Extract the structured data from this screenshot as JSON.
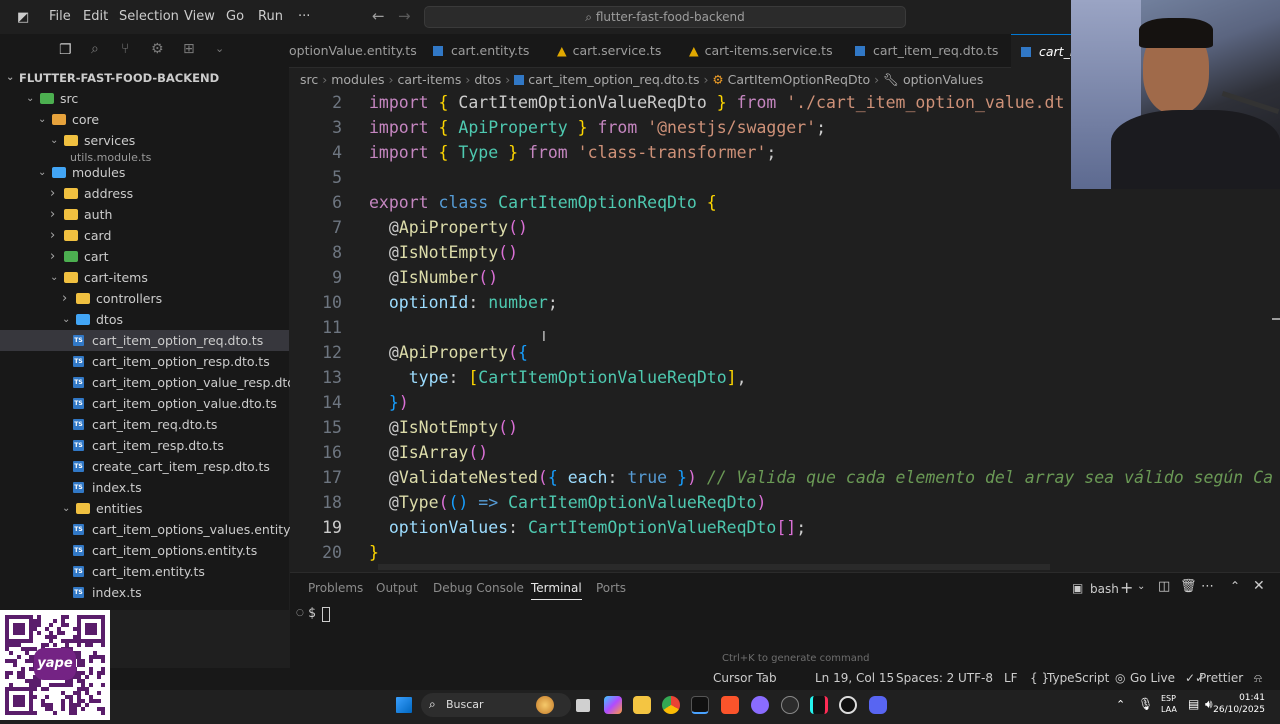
{
  "titlebar": {
    "menu": [
      "File",
      "Edit",
      "Selection",
      "View",
      "Go",
      "Run",
      "···"
    ],
    "search": "flutter-fast-food-backend"
  },
  "tabs": [
    {
      "label": "optionValue.entity.ts",
      "icon": "ts-icon"
    },
    {
      "label": "cart.entity.ts",
      "icon": "ts-icon"
    },
    {
      "label": "cart.service.ts",
      "icon": "nest-icon"
    },
    {
      "label": "cart-items.service.ts",
      "icon": "nest-icon"
    },
    {
      "label": "cart_item_req.dto.ts",
      "icon": "ts-icon"
    },
    {
      "label": "cart_i",
      "icon": "ts-icon"
    }
  ],
  "breadcrumb": [
    "src",
    "modules",
    "cart-items",
    "dtos",
    "cart_item_option_req.dto.ts",
    "CartItemOptionReqDto",
    "optionValues"
  ],
  "explorer": {
    "root": "FLUTTER-FAST-FOOD-BACKEND",
    "rows": [
      {
        "label": "src",
        "indent": 1,
        "kind": "folder-open",
        "color": "#4caf50"
      },
      {
        "label": "core",
        "indent": 2,
        "kind": "folder-open",
        "color": "#e6a23c"
      },
      {
        "label": "services",
        "indent": 3,
        "kind": "folder-open",
        "color": "#f0c040"
      },
      {
        "label": "utils.module.ts",
        "indent": 4,
        "kind": "partial",
        "color": ""
      },
      {
        "label": "modules",
        "indent": 2,
        "kind": "folder-open",
        "color": "#42a5f5"
      },
      {
        "label": "address",
        "indent": 3,
        "kind": "folder",
        "color": "#f0c040"
      },
      {
        "label": "auth",
        "indent": 3,
        "kind": "folder",
        "color": "#f0c040"
      },
      {
        "label": "card",
        "indent": 3,
        "kind": "folder",
        "color": "#f0c040"
      },
      {
        "label": "cart",
        "indent": 3,
        "kind": "folder",
        "color": "#4caf50"
      },
      {
        "label": "cart-items",
        "indent": 3,
        "kind": "folder-open",
        "color": "#f0c040"
      },
      {
        "label": "controllers",
        "indent": 4,
        "kind": "folder",
        "color": "#f0c040"
      },
      {
        "label": "dtos",
        "indent": 4,
        "kind": "folder-open",
        "color": "#42a5f5"
      },
      {
        "label": "cart_item_option_req.dto.ts",
        "indent": 5,
        "kind": "ts",
        "color": "",
        "selected": true
      },
      {
        "label": "cart_item_option_resp.dto.ts",
        "indent": 5,
        "kind": "ts",
        "color": ""
      },
      {
        "label": "cart_item_option_value_resp.dto.ts",
        "indent": 5,
        "kind": "ts",
        "color": ""
      },
      {
        "label": "cart_item_option_value.dto.ts",
        "indent": 5,
        "kind": "ts",
        "color": ""
      },
      {
        "label": "cart_item_req.dto.ts",
        "indent": 5,
        "kind": "ts",
        "color": ""
      },
      {
        "label": "cart_item_resp.dto.ts",
        "indent": 5,
        "kind": "ts",
        "color": ""
      },
      {
        "label": "create_cart_item_resp.dto.ts",
        "indent": 5,
        "kind": "ts",
        "color": ""
      },
      {
        "label": "index.ts",
        "indent": 5,
        "kind": "ts",
        "color": ""
      },
      {
        "label": "entities",
        "indent": 4,
        "kind": "folder-open",
        "color": "#f0c040"
      },
      {
        "label": "cart_item_options_values.entity.ts",
        "indent": 5,
        "kind": "ts",
        "color": ""
      },
      {
        "label": "cart_item_options.entity.ts",
        "indent": 5,
        "kind": "ts",
        "color": ""
      },
      {
        "label": "cart_item.entity.ts",
        "indent": 5,
        "kind": "ts",
        "color": ""
      },
      {
        "label": "index.ts",
        "indent": 5,
        "kind": "ts",
        "color": ""
      },
      {
        "label": "es",
        "indent": 5,
        "kind": "partial",
        "color": ""
      }
    ]
  },
  "editor": {
    "current_line": 19,
    "lines": [
      {
        "n": 2,
        "tokens": [
          [
            "kw",
            "import "
          ],
          [
            "br1",
            "{ "
          ],
          [
            "pn",
            "CartItemOptionValueReqDto "
          ],
          [
            "br1",
            "} "
          ],
          [
            "kw",
            "from "
          ],
          [
            "st",
            "'./cart_item_option_value.dt"
          ]
        ]
      },
      {
        "n": 3,
        "tokens": [
          [
            "kw",
            "import "
          ],
          [
            "br1",
            "{ "
          ],
          [
            "ty",
            "ApiProperty "
          ],
          [
            "br1",
            "} "
          ],
          [
            "kw",
            "from "
          ],
          [
            "st",
            "'@nestjs/swagger'"
          ],
          [
            "pn",
            ";"
          ]
        ]
      },
      {
        "n": 4,
        "tokens": [
          [
            "kw",
            "import "
          ],
          [
            "br1",
            "{ "
          ],
          [
            "ty",
            "Type "
          ],
          [
            "br1",
            "} "
          ],
          [
            "kw",
            "from "
          ],
          [
            "st",
            "'class-transformer'"
          ],
          [
            "pn",
            ";"
          ]
        ]
      },
      {
        "n": 5,
        "tokens": []
      },
      {
        "n": 6,
        "tokens": [
          [
            "kw",
            "export "
          ],
          [
            "kw2",
            "class "
          ],
          [
            "ty",
            "CartItemOptionReqDto "
          ],
          [
            "br1",
            "{"
          ]
        ]
      },
      {
        "n": 7,
        "tokens": [
          [
            "pn",
            "  @"
          ],
          [
            "fn",
            "ApiProperty"
          ],
          [
            "br2",
            "()"
          ]
        ]
      },
      {
        "n": 8,
        "tokens": [
          [
            "pn",
            "  @"
          ],
          [
            "fn",
            "IsNotEmpty"
          ],
          [
            "br2",
            "()"
          ]
        ]
      },
      {
        "n": 9,
        "tokens": [
          [
            "pn",
            "  @"
          ],
          [
            "fn",
            "IsNumber"
          ],
          [
            "br2",
            "()"
          ]
        ]
      },
      {
        "n": 10,
        "tokens": [
          [
            "vr",
            "  optionId"
          ],
          [
            "pn",
            ": "
          ],
          [
            "ty",
            "number"
          ],
          [
            "pn",
            ";"
          ]
        ]
      },
      {
        "n": 11,
        "tokens": []
      },
      {
        "n": 12,
        "tokens": [
          [
            "pn",
            "  @"
          ],
          [
            "fn",
            "ApiProperty"
          ],
          [
            "br2",
            "("
          ],
          [
            "br3",
            "{"
          ]
        ]
      },
      {
        "n": 13,
        "tokens": [
          [
            "vr",
            "    type"
          ],
          [
            "pn",
            ": "
          ],
          [
            "br1",
            "["
          ],
          [
            "ty",
            "CartItemOptionValueReqDto"
          ],
          [
            "br1",
            "]"
          ],
          [
            "pn",
            ","
          ]
        ]
      },
      {
        "n": 14,
        "tokens": [
          [
            "br3",
            "  }"
          ],
          [
            "br2",
            ")"
          ]
        ]
      },
      {
        "n": 15,
        "tokens": [
          [
            "pn",
            "  @"
          ],
          [
            "fn",
            "IsNotEmpty"
          ],
          [
            "br2",
            "()"
          ]
        ]
      },
      {
        "n": 16,
        "tokens": [
          [
            "pn",
            "  @"
          ],
          [
            "fn",
            "IsArray"
          ],
          [
            "br2",
            "()"
          ]
        ]
      },
      {
        "n": 17,
        "tokens": [
          [
            "pn",
            "  @"
          ],
          [
            "fn",
            "ValidateNested"
          ],
          [
            "br2",
            "("
          ],
          [
            "br3",
            "{ "
          ],
          [
            "vr",
            "each"
          ],
          [
            "pn",
            ": "
          ],
          [
            "kw2",
            "true "
          ],
          [
            "br3",
            "}"
          ],
          [
            "br2",
            ") "
          ],
          [
            "cm",
            "// Valida que cada elemento del array sea válido según Ca"
          ]
        ]
      },
      {
        "n": 18,
        "tokens": [
          [
            "pn",
            "  @"
          ],
          [
            "fn",
            "Type"
          ],
          [
            "br2",
            "("
          ],
          [
            "br3",
            "()"
          ],
          [
            "kw2",
            " => "
          ],
          [
            "ty",
            "CartItemOptionValueReqDto"
          ],
          [
            "br2",
            ")"
          ]
        ]
      },
      {
        "n": 19,
        "tokens": [
          [
            "vr",
            "  optionValues"
          ],
          [
            "pn",
            ": "
          ],
          [
            "ty",
            "CartItemOptionValueReqDto"
          ],
          [
            "br2",
            "[]"
          ],
          [
            "pn",
            ";"
          ]
        ]
      },
      {
        "n": 20,
        "tokens": [
          [
            "br1",
            "}"
          ]
        ]
      }
    ]
  },
  "panel": {
    "tabs": [
      "Problems",
      "Output",
      "Debug Console",
      "Terminal",
      "Ports"
    ],
    "active_tab": "Terminal",
    "shell": "bash",
    "prompt": "$",
    "hint": "Ctrl+K to generate command"
  },
  "status": {
    "cursor_tab": "Cursor Tab",
    "position": "Ln 19, Col 15",
    "spaces": "Spaces: 2",
    "encoding": "UTF-8",
    "eol": "LF",
    "language": "TypeScript",
    "go_live": "Go Live",
    "prettier": "Prettier"
  },
  "taskbar": {
    "search": "Buscar",
    "lang": "ESP",
    "lang2": "LAA",
    "time": "01:41",
    "date": "26/10/2025"
  },
  "qr": {
    "label": "yape"
  }
}
